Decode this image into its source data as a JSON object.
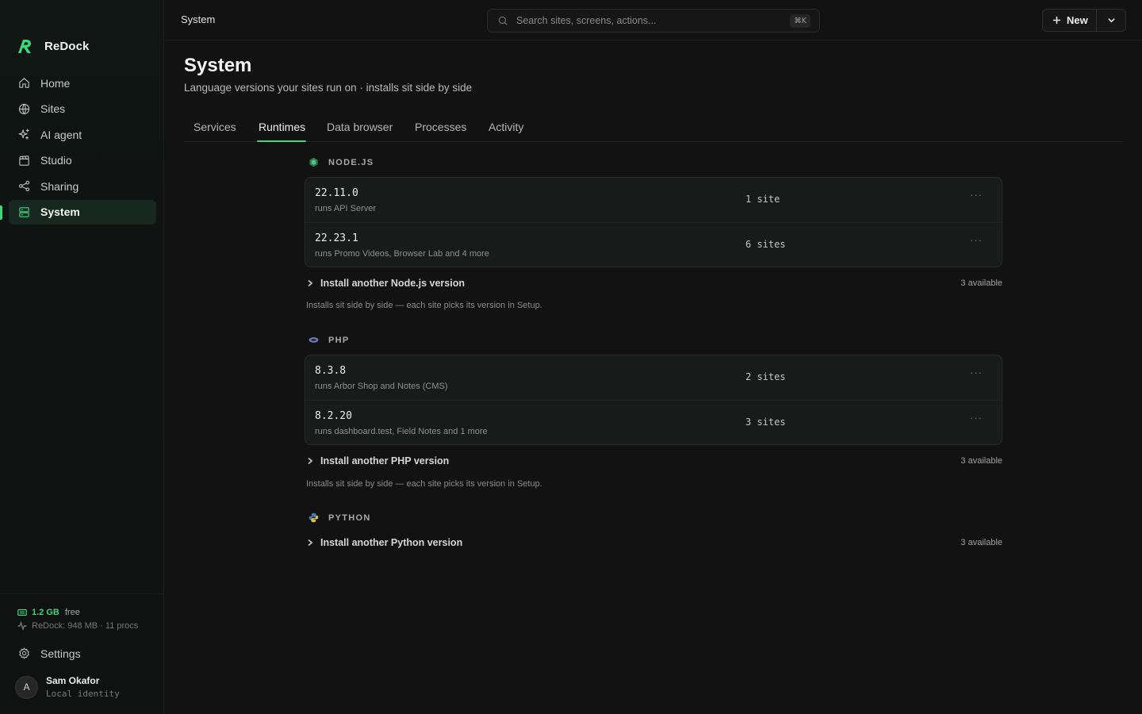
{
  "app": {
    "name": "ReDock"
  },
  "colors": {
    "accent": "#3fd67a",
    "background": "#121212",
    "card": "#191a1a"
  },
  "sidebar": {
    "items": [
      {
        "label": "Home",
        "icon": "home-icon"
      },
      {
        "label": "Sites",
        "icon": "globe-icon"
      },
      {
        "label": "AI agent",
        "icon": "sparkle-icon"
      },
      {
        "label": "Studio",
        "icon": "clapper-icon"
      },
      {
        "label": "Sharing",
        "icon": "share-icon"
      },
      {
        "label": "System",
        "icon": "server-icon",
        "active": true
      }
    ],
    "memory": {
      "value": "1.2 GB",
      "label": "free"
    },
    "process_info": "ReDock: 948 MB · 11 procs",
    "settings_label": "Settings",
    "user": {
      "initial": "A",
      "name": "Sam Okafor",
      "subtitle": "Local identity"
    }
  },
  "topbar": {
    "breadcrumb": "System",
    "search_placeholder": "Search sites, screens, actions...",
    "search_shortcut": "⌘K",
    "new_label": "New"
  },
  "page": {
    "title": "System",
    "subtitle": "Language versions your sites run on · installs sit side by side",
    "tabs": [
      {
        "label": "Services"
      },
      {
        "label": "Runtimes",
        "active": true
      },
      {
        "label": "Data browser"
      },
      {
        "label": "Processes"
      },
      {
        "label": "Activity"
      }
    ]
  },
  "runtimes": [
    {
      "name": "NODE.JS",
      "icon": "nodejs-icon",
      "versions": [
        {
          "version": "22.11.0",
          "runs": "runs API Server",
          "sites": "1 site"
        },
        {
          "version": "22.23.1",
          "runs": "runs Promo Videos, Browser Lab and 4 more",
          "sites": "6 sites"
        }
      ],
      "install_label": "Install another Node.js version",
      "available": "3 available",
      "hint": "Installs sit side by side — each site picks its version in Setup."
    },
    {
      "name": "PHP",
      "icon": "php-icon",
      "versions": [
        {
          "version": "8.3.8",
          "runs": "runs Arbor Shop and Notes (CMS)",
          "sites": "2 sites"
        },
        {
          "version": "8.2.20",
          "runs": "runs dashboard.test, Field Notes and 1 more",
          "sites": "3 sites"
        }
      ],
      "install_label": "Install another PHP version",
      "available": "3 available",
      "hint": "Installs sit side by side — each site picks its version in Setup."
    },
    {
      "name": "PYTHON",
      "icon": "python-icon",
      "versions": [],
      "install_label": "Install another Python version",
      "available": "3 available"
    }
  ]
}
